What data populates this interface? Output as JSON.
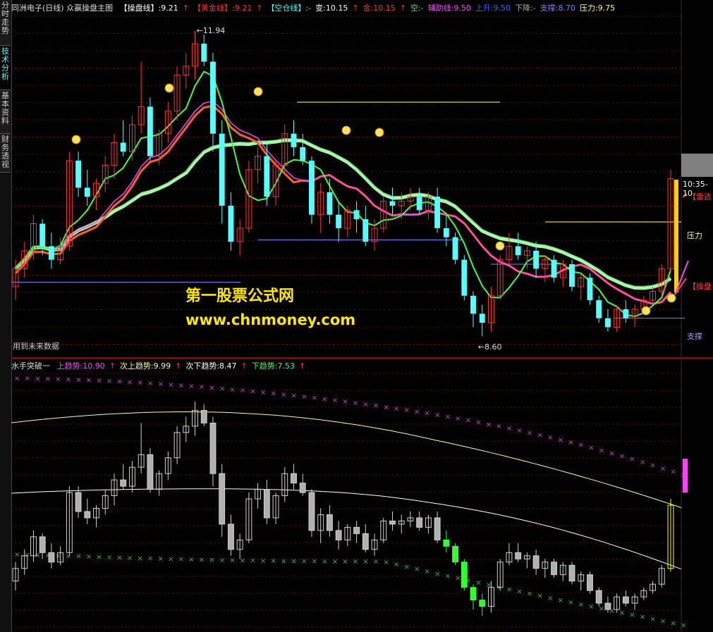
{
  "sidebar": {
    "tabs": [
      {
        "label": "分时走势",
        "active": false
      },
      {
        "label": "技术分析",
        "active": true
      },
      {
        "label": "基本资料",
        "active": false
      },
      {
        "label": "财务透视",
        "active": false
      }
    ]
  },
  "main_header": {
    "title": "同洲电子(日线) 众赢操盘主图",
    "items": [
      {
        "text": "【操盘线】:9.21",
        "color": "#ffffff"
      },
      {
        "text": "↑",
        "color": "#ff3030"
      },
      {
        "text": "【黄金线】:9.21",
        "color": "#ff3030"
      },
      {
        "text": "↑",
        "color": "#ff3030"
      },
      {
        "text": "【空仓线】:-",
        "color": "#40ffff"
      },
      {
        "text": "变:10.15",
        "color": "#ffffff"
      },
      {
        "text": "↑",
        "color": "#ff3030"
      },
      {
        "text": "金:10.15",
        "color": "#ff3030"
      },
      {
        "text": "↑",
        "color": "#ff3030"
      },
      {
        "text": "空:-",
        "color": "#40ff40"
      },
      {
        "text": "辅助线:9.50",
        "color": "#ff40ff"
      },
      {
        "text": "上升:9.50",
        "color": "#4060ff"
      },
      {
        "text": "下降:-",
        "color": "#aaaaaa"
      },
      {
        "text": "支撑:8.70",
        "color": "#8080ff"
      },
      {
        "text": "压力:9.75",
        "color": "#ffff60"
      }
    ]
  },
  "sub_header": {
    "title": "水手突破一",
    "items": [
      {
        "text": "上趋势:10.90",
        "color": "#ff40ff"
      },
      {
        "text": "↑",
        "color": "#ff3030"
      },
      {
        "text": "次上趋势:9.99",
        "color": "#ffff80"
      },
      {
        "text": "↑",
        "color": "#ff3030"
      },
      {
        "text": "次下趋势:8.47",
        "color": "#ffffff"
      },
      {
        "text": "↑",
        "color": "#ff3030"
      },
      {
        "text": "下趋势:7.53",
        "color": "#40ff40"
      },
      {
        "text": "↑",
        "color": "#ff3030"
      }
    ]
  },
  "annotations": {
    "high_price": "11.94",
    "low_price": "8.60",
    "pressure_label": "压力",
    "support_label": "支撑",
    "time_label": "10:35-10",
    "radar_label": "【雷达",
    "operate_label": "【操盘",
    "future_data_note": "用到未来数据"
  },
  "watermark": {
    "line1": "第一股票公式网",
    "line2": "www.chnmoney.com"
  },
  "colors": {
    "up": "#ff3232",
    "down": "#54ffff",
    "grid": "#800000",
    "thick_band": "#a0ffa0",
    "orange_band": "#ff6020"
  },
  "chart_data": {
    "type": "candlestick",
    "price_range": [
      8.45,
      12.05
    ],
    "candles": [
      [
        9.1,
        9.4,
        8.95,
        9.3
      ],
      [
        9.3,
        9.6,
        9.2,
        9.5
      ],
      [
        9.5,
        9.9,
        9.4,
        9.8
      ],
      [
        9.8,
        9.85,
        9.45,
        9.55
      ],
      [
        9.55,
        9.7,
        9.3,
        9.4
      ],
      [
        9.4,
        9.65,
        9.35,
        9.55
      ],
      [
        9.55,
        10.6,
        9.5,
        10.5
      ],
      [
        10.5,
        10.6,
        10.1,
        10.2
      ],
      [
        10.2,
        10.4,
        10.0,
        10.1
      ],
      [
        10.1,
        10.3,
        9.95,
        10.25
      ],
      [
        10.25,
        10.55,
        10.15,
        10.45
      ],
      [
        10.45,
        10.8,
        10.3,
        10.7
      ],
      [
        10.7,
        10.95,
        10.55,
        10.6
      ],
      [
        10.6,
        11.0,
        10.5,
        10.9
      ],
      [
        10.9,
        11.6,
        10.8,
        11.1
      ],
      [
        11.1,
        11.2,
        10.5,
        10.55
      ],
      [
        10.55,
        10.85,
        10.45,
        10.8
      ],
      [
        10.8,
        11.15,
        10.7,
        11.05
      ],
      [
        11.05,
        11.55,
        10.95,
        11.45
      ],
      [
        11.45,
        11.7,
        11.3,
        11.55
      ],
      [
        11.55,
        11.94,
        11.4,
        11.8
      ],
      [
        11.8,
        11.9,
        11.55,
        11.6
      ],
      [
        11.6,
        11.7,
        10.6,
        10.8
      ],
      [
        10.8,
        10.95,
        9.8,
        10.0
      ],
      [
        10.0,
        10.15,
        9.5,
        9.6
      ],
      [
        9.6,
        9.85,
        9.45,
        9.75
      ],
      [
        9.75,
        10.5,
        9.7,
        10.4
      ],
      [
        10.4,
        10.65,
        10.25,
        10.55
      ],
      [
        10.55,
        10.7,
        10.0,
        10.1
      ],
      [
        10.1,
        10.5,
        10.0,
        10.45
      ],
      [
        10.45,
        10.9,
        10.35,
        10.8
      ],
      [
        10.8,
        10.95,
        10.55,
        10.65
      ],
      [
        10.65,
        10.8,
        10.45,
        10.5
      ],
      [
        10.5,
        10.55,
        9.8,
        9.9
      ],
      [
        9.9,
        10.25,
        9.7,
        10.15
      ],
      [
        10.15,
        10.3,
        9.8,
        9.9
      ],
      [
        9.9,
        10.05,
        9.6,
        9.75
      ],
      [
        9.75,
        10.0,
        9.65,
        9.95
      ],
      [
        9.95,
        10.05,
        9.7,
        9.85
      ],
      [
        9.85,
        10.0,
        9.55,
        9.6
      ],
      [
        9.6,
        9.85,
        9.5,
        9.75
      ],
      [
        9.75,
        10.1,
        9.7,
        10.05
      ],
      [
        10.05,
        10.2,
        9.9,
        10.0
      ],
      [
        10.0,
        10.15,
        9.85,
        10.05
      ],
      [
        10.05,
        10.2,
        9.95,
        10.1
      ],
      [
        10.1,
        10.2,
        9.9,
        9.95
      ],
      [
        9.95,
        10.15,
        9.85,
        10.1
      ],
      [
        10.1,
        10.2,
        9.7,
        9.75
      ],
      [
        9.75,
        9.9,
        9.55,
        9.65
      ],
      [
        9.65,
        9.7,
        9.35,
        9.4
      ],
      [
        9.4,
        9.45,
        8.95,
        9.0
      ],
      [
        9.0,
        9.05,
        8.65,
        8.8
      ],
      [
        8.8,
        8.9,
        8.55,
        8.7
      ],
      [
        8.7,
        9.1,
        8.6,
        9.0
      ],
      [
        9.0,
        9.45,
        8.95,
        9.4
      ],
      [
        9.4,
        9.7,
        9.35,
        9.55
      ],
      [
        9.55,
        9.7,
        9.4,
        9.45
      ],
      [
        9.45,
        9.55,
        9.3,
        9.5
      ],
      [
        9.5,
        9.6,
        9.2,
        9.3
      ],
      [
        9.3,
        9.45,
        9.15,
        9.4
      ],
      [
        9.4,
        9.45,
        9.15,
        9.2
      ],
      [
        9.2,
        9.4,
        9.1,
        9.35
      ],
      [
        9.35,
        9.4,
        9.05,
        9.1
      ],
      [
        9.1,
        9.25,
        8.95,
        9.2
      ],
      [
        9.2,
        9.25,
        8.9,
        8.95
      ],
      [
        8.95,
        9.0,
        8.7,
        8.75
      ],
      [
        8.75,
        8.85,
        8.6,
        8.65
      ],
      [
        8.65,
        8.9,
        8.6,
        8.85
      ],
      [
        8.85,
        8.95,
        8.7,
        8.75
      ],
      [
        8.75,
        8.9,
        8.65,
        8.85
      ],
      [
        8.85,
        9.0,
        8.8,
        8.95
      ],
      [
        8.95,
        9.1,
        8.9,
        9.05
      ],
      [
        9.05,
        9.35,
        9.0,
        9.3
      ],
      [
        9.3,
        10.4,
        9.25,
        10.3
      ]
    ]
  }
}
